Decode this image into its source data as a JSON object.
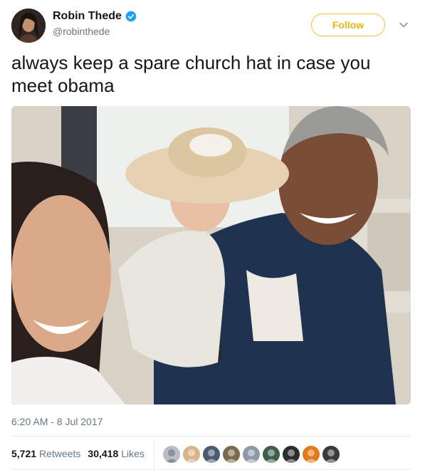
{
  "author": {
    "display_name": "Robin Thede",
    "handle": "@robinthede",
    "verified": true,
    "avatar_icon": "profile-photo-woman"
  },
  "follow_button": {
    "label": "Follow",
    "color": "#e8b416"
  },
  "more_menu_icon": "chevron-down-icon",
  "tweet": {
    "text": "always keep a spare church hat in case you meet obama",
    "media_description_icon": "photo-icon"
  },
  "meta": {
    "timestamp": "6:20 AM - 8 Jul 2017"
  },
  "stats": {
    "retweets_count": "5,721",
    "retweets_label": "Retweets",
    "likes_count": "30,418",
    "likes_label": "Likes"
  },
  "likers": [
    {
      "icon": "default-avatar-icon",
      "color": "#b8bec4"
    },
    {
      "icon": "user-avatar-icon",
      "color": "#d9b48a"
    },
    {
      "icon": "user-avatar-icon",
      "color": "#4a5a70"
    },
    {
      "icon": "user-avatar-icon",
      "color": "#7a6a4e"
    },
    {
      "icon": "user-avatar-icon",
      "color": "#8c9aa8"
    },
    {
      "icon": "user-avatar-icon",
      "color": "#3f5f4c"
    },
    {
      "icon": "user-avatar-icon",
      "color": "#2c2c2c"
    },
    {
      "icon": "user-avatar-icon",
      "color": "#e07a1a"
    },
    {
      "icon": "user-avatar-icon",
      "color": "#3a3a3a"
    }
  ]
}
